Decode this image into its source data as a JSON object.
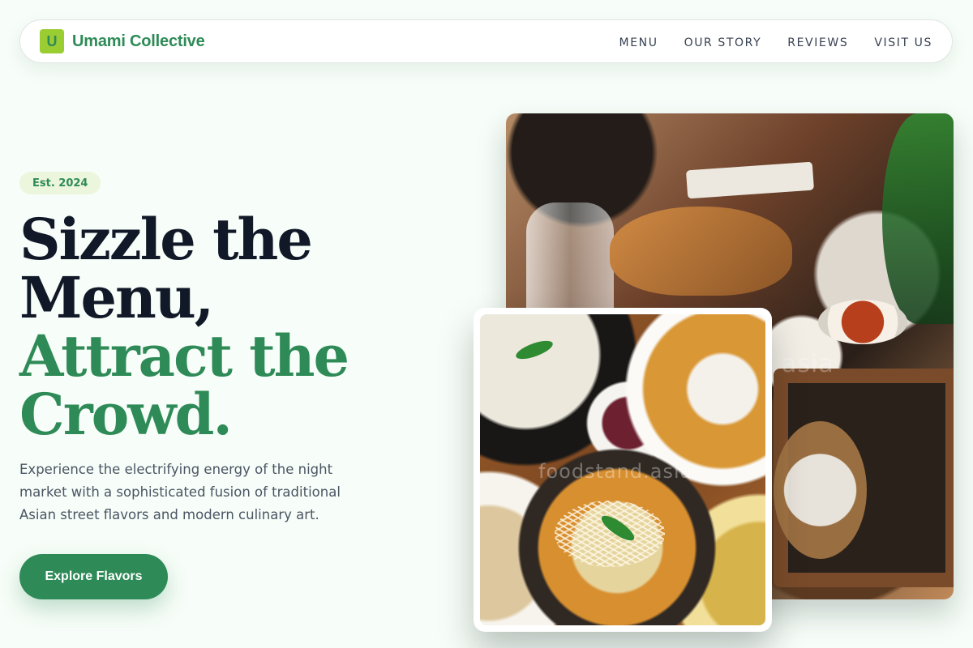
{
  "brand": {
    "logo_letter": "U",
    "name": "Umami Collective",
    "accent_color": "#2e8b57",
    "logo_color": "#9acd32"
  },
  "navigation": {
    "items": [
      {
        "label": "MENU"
      },
      {
        "label": "OUR STORY"
      },
      {
        "label": "REVIEWS"
      },
      {
        "label": "VISIT US"
      }
    ]
  },
  "hero": {
    "badge": "Est. 2024",
    "headline": {
      "line1": "Sizzle the Menu,",
      "line2": "Attract the",
      "line3": "Crowd."
    },
    "description": "Experience the electrifying energy of the night market with a sophisticated fusion of traditional Asian street flavors and modern culinary art.",
    "button_label": "Explore Flavors"
  },
  "images": {
    "main_watermark": "asia",
    "front_watermark": "foodstand.asia"
  }
}
